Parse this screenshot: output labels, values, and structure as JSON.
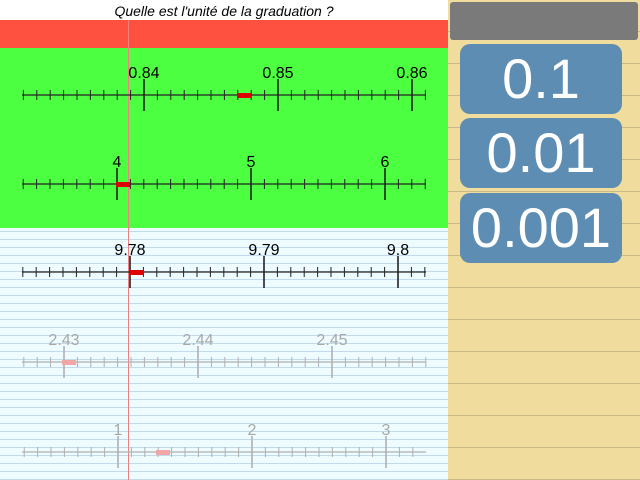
{
  "question": "Quelle est l'unité de la graduation ?",
  "answers": [
    "0.1",
    "0.01",
    "0.001"
  ],
  "colors": {
    "question_bg": "#ffffff",
    "red_band": "#ff5040",
    "green_area": "#4cff40",
    "paper": "#eefcff",
    "margin_line": "#f08080",
    "marker": "#dd0000",
    "sidebar": "#f0dc9c",
    "button": "#5d8db3",
    "display": "#7a7a7a"
  },
  "number_lines": [
    {
      "labels": [
        "0.84",
        "0.85",
        "0.86"
      ],
      "marker_minor_index": 16,
      "faded": false
    },
    {
      "labels": [
        "4",
        "5",
        "6"
      ],
      "marker_minor_index": 0,
      "faded": false
    },
    {
      "labels": [
        "9.78",
        "9.79",
        "9.8"
      ],
      "marker_minor_index": 0,
      "faded": false
    },
    {
      "labels": [
        "2.43",
        "2.44",
        "2.45"
      ],
      "marker_minor_index": 0,
      "faded": true
    },
    {
      "labels": [
        "1",
        "2",
        "3"
      ],
      "marker_minor_index": 3,
      "faded": true
    }
  ]
}
